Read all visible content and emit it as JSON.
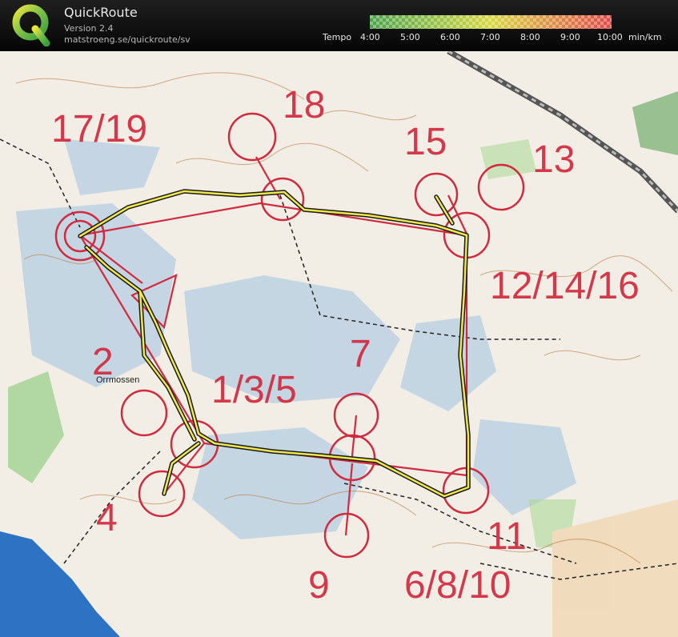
{
  "app": {
    "title": "QuickRoute",
    "version": "Version 2.4",
    "url": "matstroeng.se/quickroute/sv"
  },
  "tempo": {
    "label": "Tempo",
    "unit": "min/km",
    "ticks": [
      "4:00",
      "5:00",
      "6:00",
      "7:00",
      "8:00",
      "9:00",
      "10:00"
    ],
    "scale_colors": [
      "#4aa34a",
      "#d8d840",
      "#e04848"
    ]
  },
  "map": {
    "course_color": "#d12a3e",
    "route_color": "#f0e84a",
    "water_color": "#2e72c4",
    "control_labels": [
      "17/19",
      "18",
      "15",
      "13",
      "12/14/16",
      "2",
      "7",
      "1/3/5",
      "4",
      "9",
      "6/8/10",
      "11"
    ],
    "place_name": "Orrmossen"
  }
}
